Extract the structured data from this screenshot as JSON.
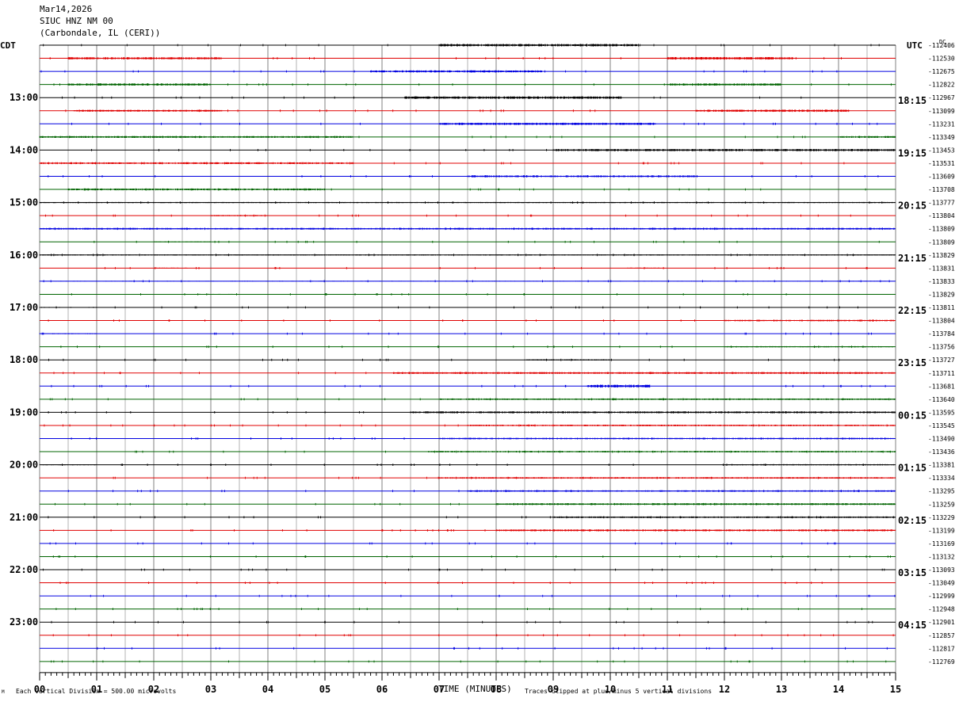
{
  "header": {
    "date": "Mar14,2026",
    "station": "SIUC HNZ NM 00",
    "location": "(Carbondale, IL (CERI))"
  },
  "labels": {
    "left_timezone": "CDT",
    "right_timezone": "UTC",
    "dc_label": "DC",
    "x_axis_title": "TIME (MINUTES)",
    "scale_note": "Each Vertical Division =  500.00 microvolts",
    "clip_note": "Traces clipped at plus/minus 5 vertical divisions",
    "corner_mark": "M"
  },
  "colors": {
    "trace_cycle": [
      "#000000",
      "#e00000",
      "#0000e0",
      "#006400"
    ],
    "grid": "#808080",
    "background": "#ffffff"
  },
  "chart_data": {
    "type": "helicorder",
    "x_ticks": [
      "00",
      "01",
      "02",
      "03",
      "04",
      "05",
      "06",
      "07",
      "08",
      "09",
      "10",
      "11",
      "12",
      "13",
      "14",
      "15"
    ],
    "xlim": [
      0,
      15
    ],
    "minutes_per_line": 15,
    "left_hour_labels": [
      "13:00",
      "14:00",
      "15:00",
      "16:00",
      "17:00",
      "18:00",
      "19:00",
      "20:00",
      "21:00",
      "22:00",
      "23:00"
    ],
    "right_hour_labels": [
      "18:15",
      "19:15",
      "20:15",
      "21:15",
      "22:15",
      "23:15",
      "00:15",
      "01:15",
      "02:15",
      "03:15",
      "04:15"
    ],
    "dc_values": [
      "-112406",
      "-112530",
      "-112675",
      "-112822",
      "-112967",
      "-113099",
      "-113231",
      "-113349",
      "-113453",
      "-113531",
      "-113609",
      "-113708",
      "-113777",
      "-113804",
      "-113809",
      "-113809",
      "-113829",
      "-113831",
      "-113833",
      "-113829",
      "-113811",
      "-113804",
      "-113784",
      "-113756",
      "-113727",
      "-113711",
      "-113681",
      "-113640",
      "-113595",
      "-113545",
      "-113490",
      "-113436",
      "-113381",
      "-113334",
      "-113295",
      "-113259",
      "-113229",
      "-113199",
      "-113169",
      "-113132",
      "-113093",
      "-113049",
      "-112999",
      "-112948",
      "-112901",
      "-112857",
      "-112817",
      "-112769"
    ],
    "noise_bursts": [
      [
        [
          7.0,
          10.5,
          0.8
        ]
      ],
      [
        [
          0.5,
          3.2,
          0.7
        ],
        [
          11.0,
          13.2,
          0.8
        ]
      ],
      [
        [
          5.8,
          8.8,
          0.7
        ]
      ],
      [
        [
          0.5,
          3.0,
          0.7
        ],
        [
          11.0,
          13.0,
          0.7
        ]
      ],
      [
        [
          6.4,
          10.2,
          0.8
        ]
      ],
      [
        [
          0.6,
          3.2,
          0.6
        ],
        [
          11.5,
          14.2,
          0.7
        ]
      ],
      [
        [
          7.0,
          10.8,
          0.7
        ]
      ],
      [
        [
          0.0,
          5.5,
          0.6
        ],
        [
          14.0,
          15.0,
          0.6
        ]
      ],
      [
        [
          9.0,
          15.0,
          0.7
        ]
      ],
      [
        [
          0.0,
          5.5,
          0.6
        ]
      ],
      [
        [
          7.5,
          11.5,
          0.6
        ]
      ],
      [
        [
          0.5,
          5.0,
          0.6
        ]
      ],
      [
        [
          0.0,
          15.0,
          0.35
        ]
      ],
      [
        [
          3.0,
          4.0,
          0.4
        ]
      ],
      [
        [
          0.0,
          15.0,
          0.55
        ]
      ],
      [
        [
          2.0,
          3.0,
          0.3
        ]
      ],
      [
        [
          0.0,
          15.0,
          0.35
        ]
      ],
      [
        [
          2.0,
          2.6,
          0.3
        ],
        [
          10.3,
          10.9,
          0.3
        ]
      ],
      [
        [
          0.0,
          15.0,
          0.25
        ]
      ],
      [
        [
          2.8,
          3.4,
          0.3
        ]
      ],
      [
        [
          0.0,
          1.0,
          0.3
        ]
      ],
      [
        [
          12.0,
          15.0,
          0.5
        ]
      ],
      [
        [
          0.0,
          1.0,
          0.3
        ]
      ],
      [
        [
          12.0,
          15.0,
          0.4
        ]
      ],
      [
        [
          8.5,
          10.0,
          0.4
        ]
      ],
      [
        [
          6.2,
          15.0,
          0.6
        ]
      ],
      [
        [
          9.6,
          10.7,
          0.9
        ]
      ],
      [
        [
          7.0,
          15.0,
          0.5
        ]
      ],
      [
        [
          6.5,
          15.0,
          0.6
        ]
      ],
      [
        [
          7.5,
          15.0,
          0.5
        ]
      ],
      [
        [
          7.0,
          15.0,
          0.5
        ]
      ],
      [
        [
          6.8,
          15.0,
          0.5
        ]
      ],
      [
        [
          0.0,
          1.0,
          0.3
        ],
        [
          12.0,
          15.0,
          0.4
        ]
      ],
      [
        [
          7.0,
          15.0,
          0.5
        ]
      ],
      [
        [
          7.5,
          15.0,
          0.5
        ]
      ],
      [
        [
          8.0,
          15.0,
          0.6
        ]
      ],
      [
        [
          9.0,
          15.0,
          0.5
        ]
      ],
      [
        [
          8.0,
          15.0,
          0.6
        ]
      ]
    ]
  }
}
